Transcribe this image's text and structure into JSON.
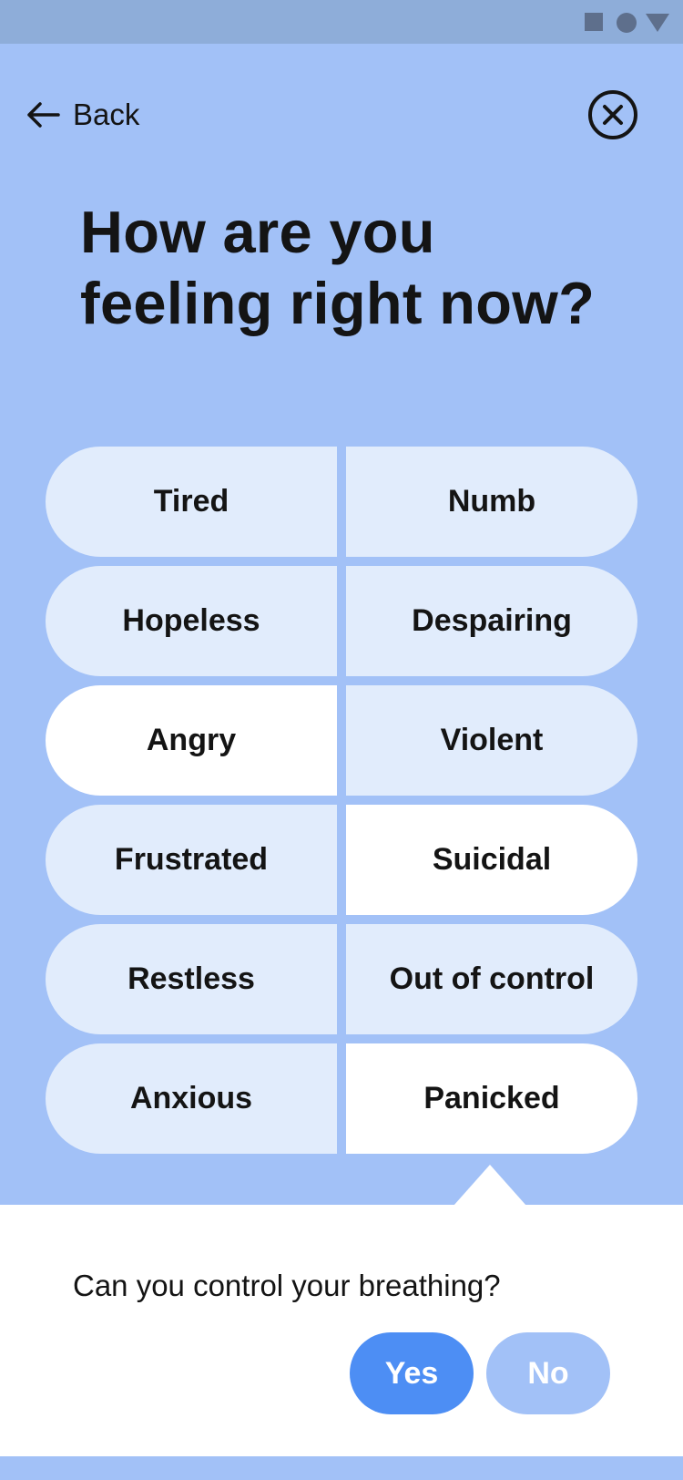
{
  "header": {
    "back_label": "Back"
  },
  "title": "How are you\nfeeling right now?",
  "options": [
    {
      "label": "Tired",
      "selected": false
    },
    {
      "label": "Numb",
      "selected": false
    },
    {
      "label": "Hopeless",
      "selected": false
    },
    {
      "label": "Despairing",
      "selected": false
    },
    {
      "label": "Angry",
      "selected": true
    },
    {
      "label": "Violent",
      "selected": false
    },
    {
      "label": "Frustrated",
      "selected": false
    },
    {
      "label": "Suicidal",
      "selected": true
    },
    {
      "label": "Restless",
      "selected": false
    },
    {
      "label": "Out of control",
      "selected": false
    },
    {
      "label": "Anxious",
      "selected": false
    },
    {
      "label": "Panicked",
      "selected": true
    }
  ],
  "prompt": {
    "question": "Can you control your breathing?",
    "yes_label": "Yes",
    "no_label": "No"
  },
  "icons": {
    "back": "arrow-left-icon",
    "close": "close-circle-icon",
    "status": [
      "square-icon",
      "circle-icon",
      "triangle-icon"
    ]
  },
  "colors": {
    "background": "#a2c1f7",
    "status_bar": "#8eadd9",
    "option_default": "#e1ecfc",
    "option_selected": "#ffffff",
    "primary": "#4d8ef4"
  }
}
